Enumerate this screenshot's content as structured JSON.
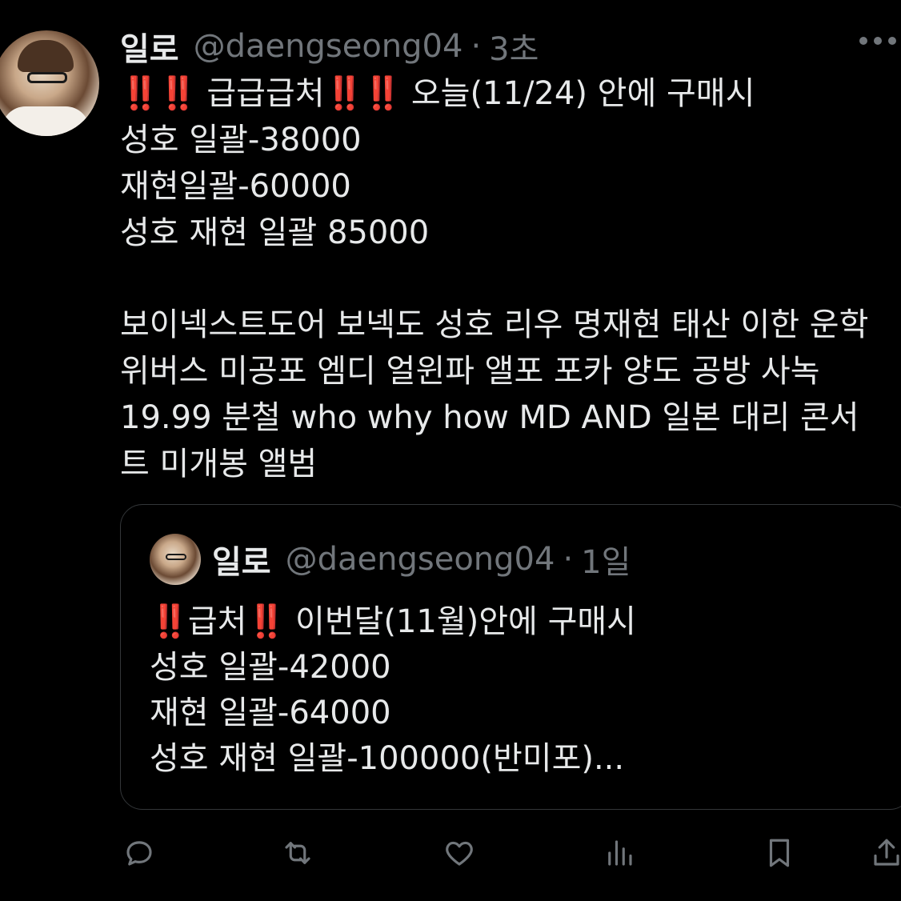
{
  "tweet": {
    "author_name": "일로",
    "author_handle": "@daengseong04",
    "separator": "·",
    "time": "3초",
    "lines": [
      {
        "pre": "",
        "mark1": "‼️‼️",
        "mid": " 급급급처",
        "mark2": "‼️‼️",
        "post": " 오늘(11/24) 안에 구매시"
      },
      "성호 일괄-38000",
      "재현일괄-60000",
      "성호 재현 일괄 85000",
      "",
      "보이넥스트도어 보넥도 성호 리우 명재현 태산 이한 운학",
      "위버스 미공포 엠디 얼윈파 앨포 포카 양도 공방 사녹",
      "19.99 분철 who why how MD AND 일본 대리 콘서",
      "트 미개봉 앨범"
    ]
  },
  "quote": {
    "author_name": "일로",
    "author_handle": "@daengseong04",
    "separator": "·",
    "time": "1일",
    "first_line": {
      "mark1": "‼️",
      "mid": "급처",
      "mark2": "‼️",
      "post": " 이번달(11월)안에 구매시"
    },
    "lines": [
      "성호 일괄-42000",
      "재현 일괄-64000",
      "성호 재현 일괄-100000(반미포)..."
    ]
  },
  "actions": [
    "reply-icon",
    "retweet-icon",
    "like-icon",
    "views-icon",
    "bookmark-icon",
    "share-icon"
  ],
  "colors": {
    "background": "#000000",
    "text": "#e7e9ea",
    "secondary": "#71767b",
    "border": "#333639",
    "alert": "#e0201a"
  }
}
